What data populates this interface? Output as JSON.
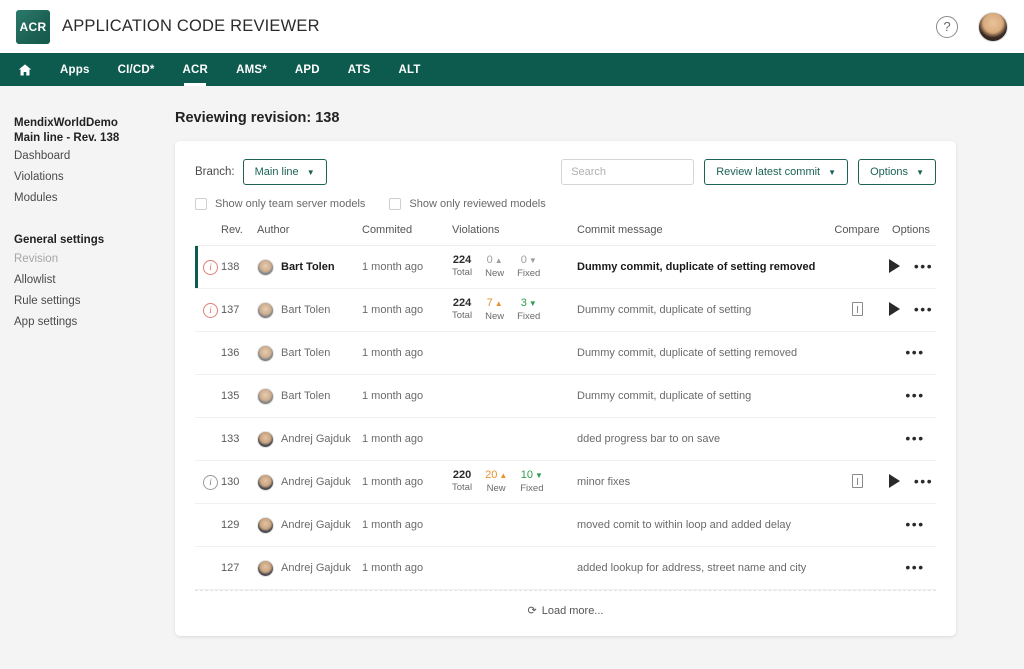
{
  "header": {
    "logo_text": "ACR",
    "app_title": "APPLICATION CODE REVIEWER",
    "help_icon": "question-mark-icon",
    "avatar": "user-avatar"
  },
  "nav": {
    "home_icon": "home-icon",
    "items": [
      {
        "label": "Apps",
        "active": false
      },
      {
        "label": "CI/CD*",
        "active": false
      },
      {
        "label": "ACR",
        "active": true
      },
      {
        "label": "AMS*",
        "active": false
      },
      {
        "label": "APD",
        "active": false
      },
      {
        "label": "ATS",
        "active": false
      },
      {
        "label": "ALT",
        "active": false
      }
    ]
  },
  "sidebar": {
    "project_name": "MendixWorldDemo",
    "project_branch": "Main line - Rev. 138",
    "items": [
      {
        "label": "Dashboard",
        "muted": false
      },
      {
        "label": "Violations",
        "muted": false
      },
      {
        "label": "Modules",
        "muted": false
      }
    ],
    "group_title": "General settings",
    "settings_items": [
      {
        "label": "Revision",
        "muted": true
      },
      {
        "label": "Allowlist",
        "muted": false
      },
      {
        "label": "Rule settings",
        "muted": false
      },
      {
        "label": "App settings",
        "muted": false
      }
    ]
  },
  "main": {
    "page_title": "Reviewing revision: 138",
    "toolbar": {
      "branch_label": "Branch:",
      "branch_value": "Main line",
      "search_placeholder": "Search",
      "search_value": "",
      "review_button": "Review latest commit",
      "options_button": "Options"
    },
    "filters": [
      {
        "label": "Show only team server models",
        "checked": false
      },
      {
        "label": "Show only reviewed models",
        "checked": false
      }
    ],
    "table": {
      "columns": [
        "Rev.",
        "Author",
        "Commited",
        "Violations",
        "Commit message",
        "Compare",
        "Options"
      ],
      "violation_captions": {
        "total": "Total",
        "new": "New",
        "fixed": "Fixed"
      },
      "rows": [
        {
          "active": true,
          "info_icon": "info-icon",
          "info_style": "red",
          "rev": "138",
          "author": "Bart Tolen",
          "avatar": "bart",
          "committed": "1 month ago",
          "has_violations": true,
          "total": "224",
          "new": "0",
          "new_warn": false,
          "fixed": "0",
          "fixed_good": false,
          "message": "Dummy commit, duplicate of setting removed",
          "compare": false,
          "play": true
        },
        {
          "active": false,
          "info_icon": "info-icon",
          "info_style": "red",
          "rev": "137",
          "author": "Bart Tolen",
          "avatar": "bart",
          "committed": "1 month ago",
          "has_violations": true,
          "total": "224",
          "new": "7",
          "new_warn": true,
          "fixed": "3",
          "fixed_good": true,
          "message": "Dummy commit, duplicate of setting",
          "compare": true,
          "play": true
        },
        {
          "active": false,
          "info_icon": null,
          "info_style": null,
          "rev": "136",
          "author": "Bart Tolen",
          "avatar": "bart",
          "committed": "1 month ago",
          "has_violations": false,
          "total": "",
          "new": "",
          "new_warn": false,
          "fixed": "",
          "fixed_good": false,
          "message": "Dummy commit, duplicate of setting removed",
          "compare": false,
          "play": false
        },
        {
          "active": false,
          "info_icon": null,
          "info_style": null,
          "rev": "135",
          "author": "Bart Tolen",
          "avatar": "bart",
          "committed": "1 month ago",
          "has_violations": false,
          "total": "",
          "new": "",
          "new_warn": false,
          "fixed": "",
          "fixed_good": false,
          "message": "Dummy commit, duplicate of setting",
          "compare": false,
          "play": false
        },
        {
          "active": false,
          "info_icon": null,
          "info_style": null,
          "rev": "133",
          "author": "Andrej Gajduk",
          "avatar": "andrej",
          "committed": "1 month ago",
          "has_violations": false,
          "total": "",
          "new": "",
          "new_warn": false,
          "fixed": "",
          "fixed_good": false,
          "message": "dded progress bar to on save",
          "compare": false,
          "play": false
        },
        {
          "active": false,
          "info_icon": "info-icon",
          "info_style": "grey",
          "rev": "130",
          "author": "Andrej Gajduk",
          "avatar": "andrej",
          "committed": "1 month ago",
          "has_violations": true,
          "total": "220",
          "new": "20",
          "new_warn": true,
          "fixed": "10",
          "fixed_good": true,
          "message": "minor fixes",
          "compare": true,
          "play": true
        },
        {
          "active": false,
          "info_icon": null,
          "info_style": null,
          "rev": "129",
          "author": "Andrej Gajduk",
          "avatar": "andrej",
          "committed": "1 month ago",
          "has_violations": false,
          "total": "",
          "new": "",
          "new_warn": false,
          "fixed": "",
          "fixed_good": false,
          "message": "moved comit to within loop and added delay",
          "compare": false,
          "play": false
        },
        {
          "active": false,
          "info_icon": null,
          "info_style": null,
          "rev": "127",
          "author": "Andrej Gajduk",
          "avatar": "andrej",
          "committed": "1 month ago",
          "has_violations": false,
          "total": "",
          "new": "",
          "new_warn": false,
          "fixed": "",
          "fixed_good": false,
          "message": "added lookup for address, street name and city",
          "compare": false,
          "play": false
        }
      ]
    },
    "load_more": "Load more...",
    "load_more_icon": "refresh-icon"
  },
  "colors": {
    "brand_green": "#0d5a4e",
    "accent_orange": "#e8912b",
    "accent_green": "#2f9e4f",
    "info_red": "#d4695c"
  }
}
